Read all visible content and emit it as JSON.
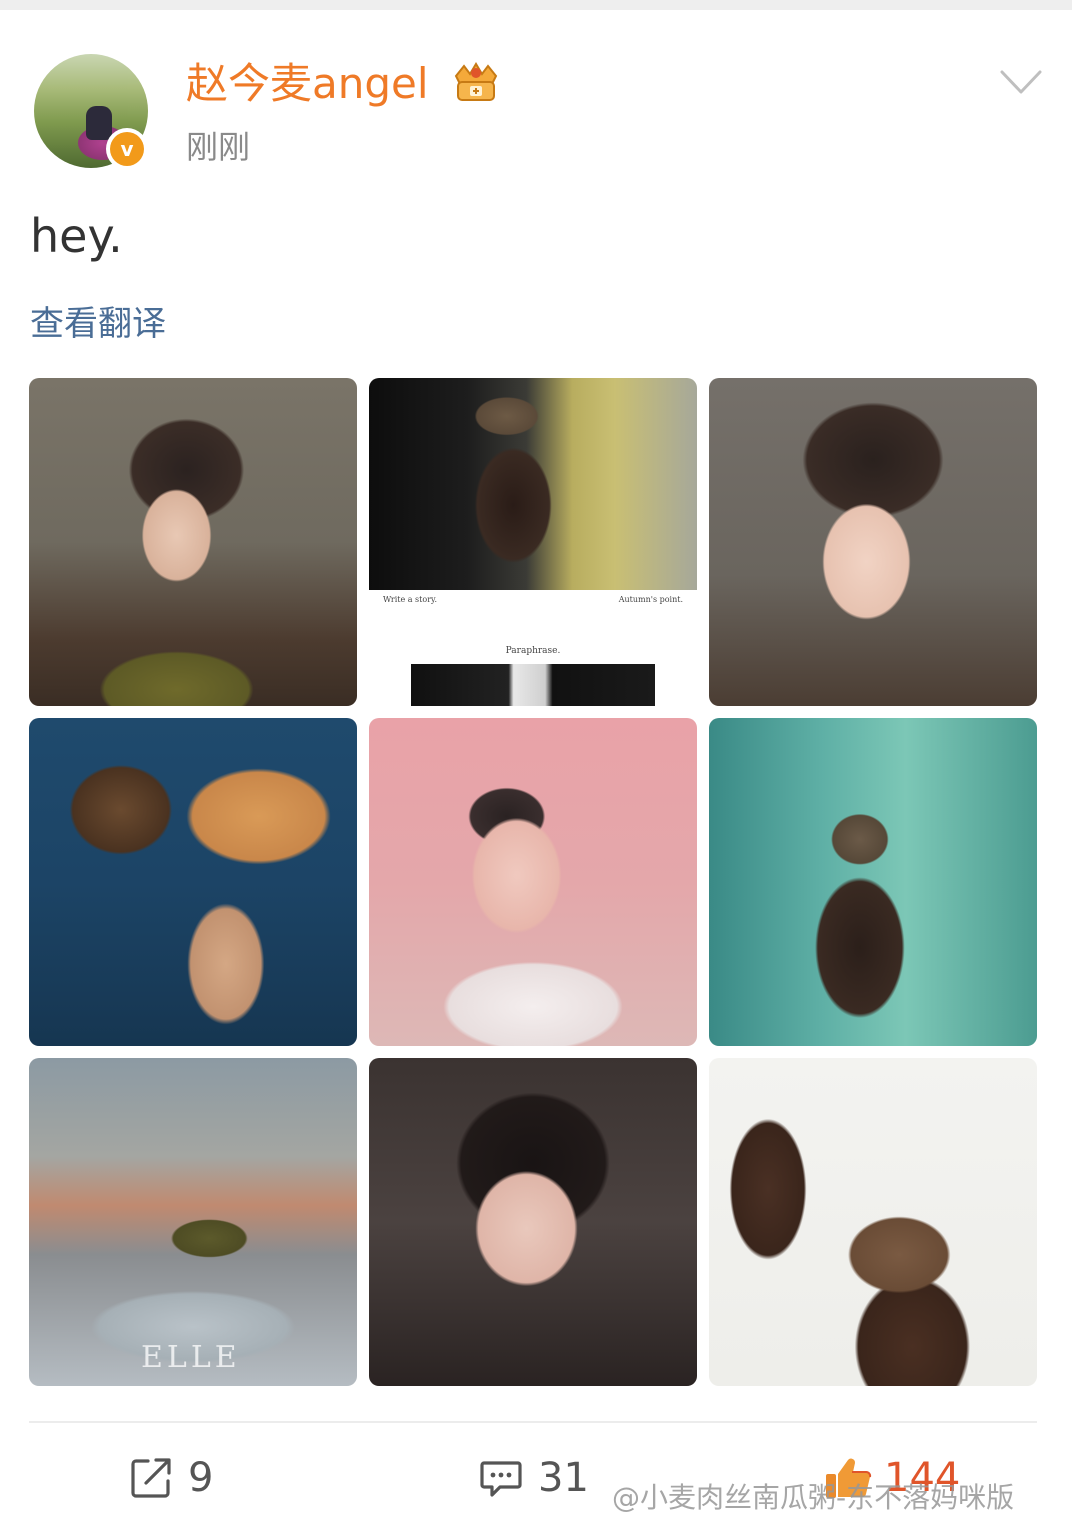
{
  "post": {
    "username": "赵今麦angel",
    "timestamp": "刚刚",
    "text": "hey.",
    "translate_link": "查看翻译",
    "verified_badge": "v"
  },
  "photos": {
    "p2_caption_left": "Write a story.",
    "p2_caption_right": "Autumn's point.",
    "p2_caption_center": "Paraphrase.",
    "p7_mark": "ELLE"
  },
  "actions": {
    "share_count": "9",
    "comment_count": "31",
    "like_count": "144"
  },
  "watermark": "@小麦肉丝南瓜粥-东不落妈咪版",
  "colors": {
    "username": "#ef7a27",
    "link": "#4a6d96",
    "like": "#e0552a",
    "badge": "#f29a1a"
  }
}
